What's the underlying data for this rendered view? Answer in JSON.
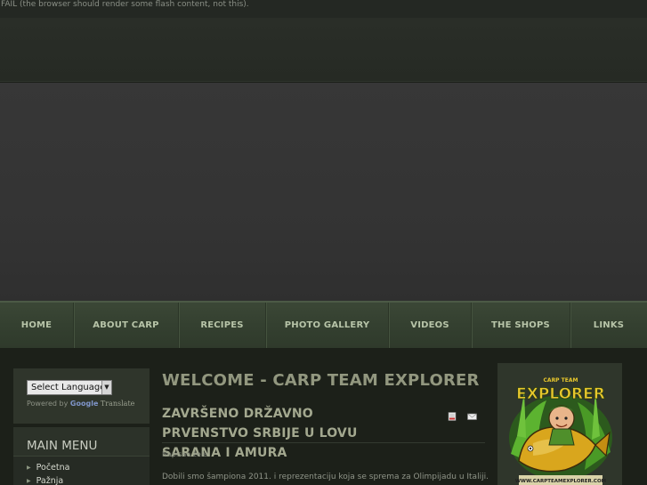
{
  "flash_message": "FAIL (the browser should render some flash content, not this).",
  "nav": {
    "items": [
      {
        "label": "HOME"
      },
      {
        "label": "ABOUT CARP"
      },
      {
        "label": "RECIPES"
      },
      {
        "label": "PHOTO GALLERY"
      },
      {
        "label": "VIDEOS"
      },
      {
        "label": "THE SHOPS"
      },
      {
        "label": "LINKS"
      }
    ]
  },
  "language": {
    "select_label": "Select Language",
    "powered_by": "Powered by",
    "google": "Google",
    "translate": "Translate"
  },
  "main_menu": {
    "title": "MAIN MENU",
    "items": [
      {
        "label": "Početna"
      },
      {
        "label": "Pažnja"
      }
    ]
  },
  "content": {
    "welcome": "WELCOME - CARP TEAM EXPLORER",
    "article_title": "ZAVRŠENO DRŽAVNO PRVENSTVO SRBIJE U LOVU SARANA I AMURA",
    "author": "Napisao žele",
    "body_start": "Dobili smo šampiona 2011. i reprezentaciju koja se sprema za Olimpijadu u Italiji."
  },
  "logo": {
    "top_text": "CARP TEAM",
    "name": "EXPLORER",
    "bottom_text": "WWW.CARPTEAMEXPLORER.COM"
  },
  "colors": {
    "nav_text": "#b7c4a8",
    "logo_green": "#4fa32a",
    "logo_yellow": "#e8c72c",
    "heading": "#92977f"
  }
}
